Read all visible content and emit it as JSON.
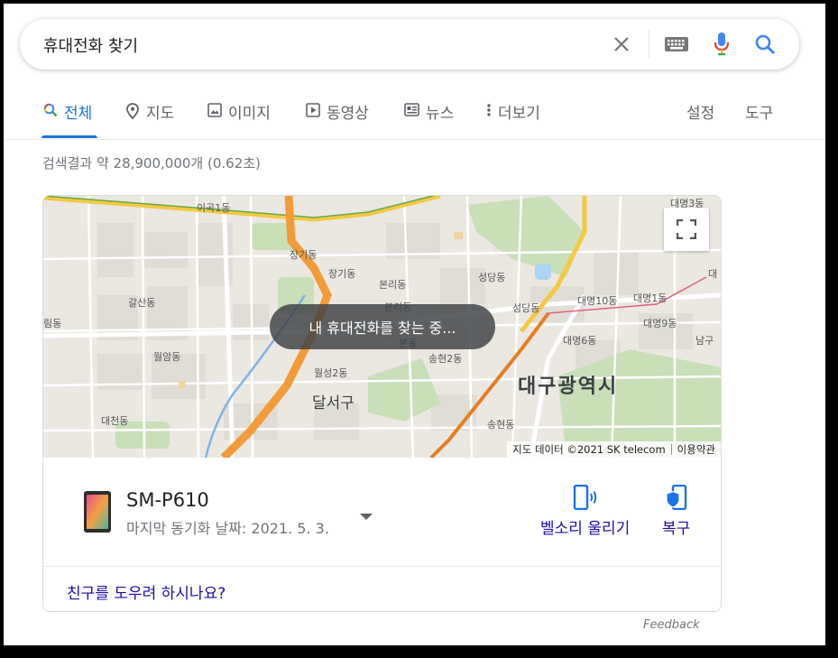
{
  "search": {
    "query": "휴대전화 찾기"
  },
  "tabs": [
    {
      "label": "전체",
      "active": true
    },
    {
      "label": "지도"
    },
    {
      "label": "이미지"
    },
    {
      "label": "동영상"
    },
    {
      "label": "뉴스"
    },
    {
      "label": "더보기"
    },
    {
      "label": "설정"
    },
    {
      "label": "도구"
    }
  ],
  "result_stats": "검색결과 약 28,900,000개 (0.62초)",
  "map": {
    "status": "내 휴대전화를 찾는 중...",
    "attribution": "지도 데이터 ©2021 SK telecom",
    "terms": "이용약관",
    "labels": {
      "igok": "이곡1동",
      "jangi1": "장기동",
      "jangi2": "장기동",
      "bonri1": "본리동",
      "bonri2": "본리동",
      "bon": "본동",
      "galsan": "갈산동",
      "wolam": "월암동",
      "wolseong2": "월성2동",
      "songhyeon2": "송현2동",
      "dalseo": "달서구",
      "seongdang1": "성당동",
      "seongdang2": "성당동",
      "daemyeong10": "대명10동",
      "daemyeong1": "대명1동",
      "daemyeong9": "대명9동",
      "daemyeong6": "대명6동",
      "daemyeong3": "대명3동",
      "daegu": "대구광역시",
      "songhyeon": "송현동",
      "daecheon": "대천동",
      "nam": "남구",
      "leftdong": "림동",
      "rightdae": "대"
    }
  },
  "device": {
    "name": "SM-P610",
    "sync": "마지막 동기화 날짜: 2021. 5. 3.",
    "ring_label": "벨소리 울리기",
    "recover_label": "복구"
  },
  "help_link": "친구를 도우려 하시나요?",
  "feedback": "Feedback",
  "colors": {
    "accent": "#1a73e8",
    "link": "#1a0dab"
  }
}
